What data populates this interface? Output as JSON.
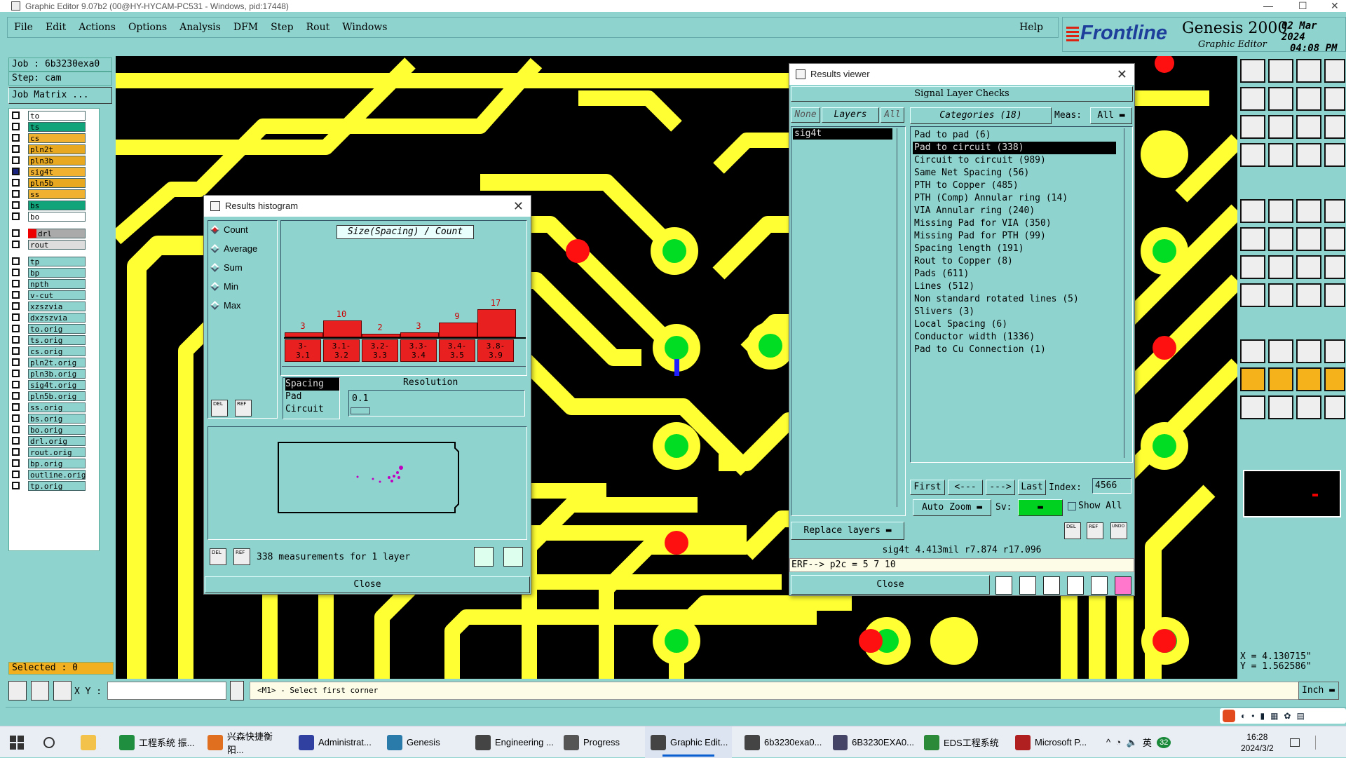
{
  "window_title": "Graphic Editor 9.07b2 (00@HY-HYCAM-PC531 - Windows, pid:17448)",
  "menu": [
    "File",
    "Edit",
    "Actions",
    "Options",
    "Analysis",
    "DFM",
    "Step",
    "Rout",
    "Windows"
  ],
  "help": "Help",
  "brand": {
    "logo": "Frontline",
    "product": "Genesis 2000",
    "subtitle": "Graphic Editor",
    "date": "02 Mar 2024",
    "time": "04:08 PM"
  },
  "job": {
    "job_label": "Job : 6b3230exa0",
    "step_label": "Step: cam",
    "matrix_button": "Job Matrix ..."
  },
  "layers": [
    {
      "name": "to",
      "color": "#ffffff"
    },
    {
      "name": "ts",
      "color": "#11a37a"
    },
    {
      "name": "cs",
      "color": "#f0b030"
    },
    {
      "name": "pln2t",
      "color": "#e8a820"
    },
    {
      "name": "pln3b",
      "color": "#e8a820"
    },
    {
      "name": "sig4t",
      "color": "#f0b030",
      "active": true
    },
    {
      "name": "pln5b",
      "color": "#e8a820"
    },
    {
      "name": "ss",
      "color": "#f0b030"
    },
    {
      "name": "bs",
      "color": "#11a37a"
    },
    {
      "name": "bo",
      "color": "#ffffff"
    },
    {
      "name": "drl",
      "color": "#aaaaaa"
    },
    {
      "name": "rout",
      "color": "#dddddd"
    },
    {
      "name": "tp",
      "color": "#8fd3cf"
    },
    {
      "name": "bp",
      "color": "#8fd3cf"
    },
    {
      "name": "npth",
      "color": "#8fd3cf"
    },
    {
      "name": "v-cut",
      "color": "#8fd3cf"
    },
    {
      "name": "xzszvia",
      "color": "#8fd3cf"
    },
    {
      "name": "dxzszvia",
      "color": "#8fd3cf"
    },
    {
      "name": "to.orig",
      "color": "#8fd3cf"
    },
    {
      "name": "ts.orig",
      "color": "#8fd3cf"
    },
    {
      "name": "cs.orig",
      "color": "#8fd3cf"
    },
    {
      "name": "pln2t.orig",
      "color": "#8fd3cf"
    },
    {
      "name": "pln3b.orig",
      "color": "#8fd3cf"
    },
    {
      "name": "sig4t.orig",
      "color": "#8fd3cf"
    },
    {
      "name": "pln5b.orig",
      "color": "#8fd3cf"
    },
    {
      "name": "ss.orig",
      "color": "#8fd3cf"
    },
    {
      "name": "bs.orig",
      "color": "#8fd3cf"
    },
    {
      "name": "bo.orig",
      "color": "#8fd3cf"
    },
    {
      "name": "drl.orig",
      "color": "#8fd3cf"
    },
    {
      "name": "rout.orig",
      "color": "#8fd3cf"
    },
    {
      "name": "bp.orig",
      "color": "#8fd3cf"
    },
    {
      "name": "outline.orig",
      "color": "#8fd3cf"
    },
    {
      "name": "tp.orig",
      "color": "#8fd3cf"
    }
  ],
  "selected": "Selected : 0",
  "histogram": {
    "title": "Results histogram",
    "stats": [
      "Count",
      "Average",
      "Sum",
      "Min",
      "Max"
    ],
    "selected_stat": "Count",
    "chart_title": "Size(Spacing) / Count",
    "chart_data": {
      "type": "bar",
      "categories": [
        "3-3.1",
        "3.1-3.2",
        "3.2-3.3",
        "3.3-3.4",
        "3.4-3.5",
        "3.8-3.9"
      ],
      "values": [
        3,
        10,
        2,
        3,
        9,
        17
      ],
      "title": "Size(Spacing) / Count",
      "ylim": [
        0,
        17
      ]
    },
    "params": [
      "Spacing",
      "Pad",
      "Circuit"
    ],
    "resolution_label": "Resolution",
    "resolution_value": "0.1",
    "del": "DEL",
    "ref": "REF",
    "measurements": "338 measurements for 1 layer",
    "close": "Close"
  },
  "results": {
    "title": "Results viewer",
    "header": "Signal Layer Checks",
    "none": "None",
    "layers": "Layers",
    "all": "All",
    "layer_list": [
      "sig4t"
    ],
    "categories_label": "Categories (18)",
    "meas_label": "Meas:",
    "meas_value": "All",
    "categories": [
      "Pad to pad (6)",
      "Pad to circuit (338)",
      "Circuit to circuit (989)",
      "Same Net Spacing (56)",
      "PTH to Copper (485)",
      "PTH (Comp) Annular ring (14)",
      "VIA Annular ring (240)",
      "Missing Pad for VIA (350)",
      "Missing Pad for PTH (99)",
      "Spacing length (191)",
      "Rout to Copper (8)",
      "Pads (611)",
      "Lines (512)",
      "Non standard rotated lines (5)",
      "Slivers (3)",
      "Local Spacing (6)",
      "Conductor width (1336)",
      "Pad to Cu Connection (1)"
    ],
    "selected_category": 1,
    "first": "First",
    "prev": "<---",
    "next": "--->",
    "last": "Last",
    "index_label": "Index:",
    "index_value": "4566",
    "auto_zoom": "Auto Zoom",
    "sv_label": "Sv:",
    "show_all": "Show All",
    "replace_layers": "Replace layers",
    "info": "sig4t 4.413mil  r7.874  r17.096",
    "erf": "ERF--> p2c = 5 7 10",
    "close": "Close",
    "del": "DEL",
    "ref": "REF",
    "undo": "UNDO"
  },
  "coords": {
    "x": "X = 4.130715\"",
    "y": "Y = 1.562586\""
  },
  "status": {
    "xy_label": "X Y :",
    "prompt": "<M1> - Select first corner",
    "units": "Inch"
  },
  "taskbar": {
    "items": [
      "工程系统 振...",
      "兴森快捷衡阳...",
      "Administrat...",
      "Genesis",
      "Engineering ...",
      "Progress",
      "Graphic Edit...",
      "6b3230exa0...",
      "6B3230EXA0...",
      "EDS工程系统",
      "Microsoft P..."
    ],
    "tray": [
      "英",
      "32"
    ],
    "time": "16:28",
    "date": "2024/3/2"
  }
}
